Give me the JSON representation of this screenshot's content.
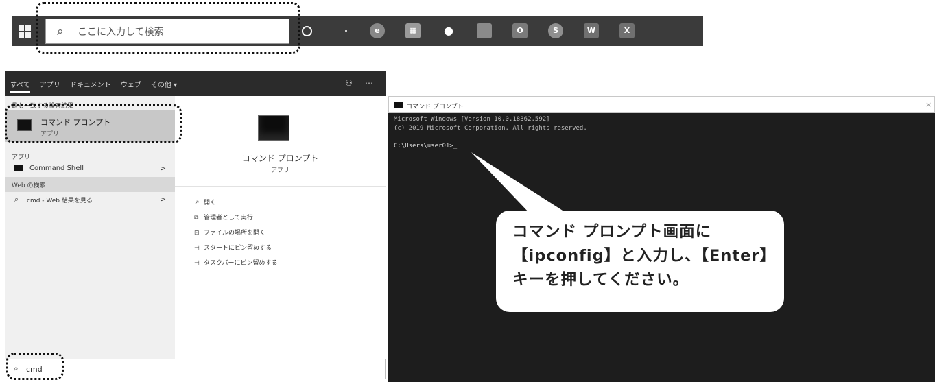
{
  "taskbar": {
    "search_icon": "search-icon",
    "search_placeholder": "ここに入力して検索",
    "apps": [
      "edge-icon",
      "calculator-icon",
      "wechat-icon",
      "file-explorer-icon",
      "outlook-icon",
      "skype-icon",
      "word-icon",
      "excel-icon"
    ]
  },
  "start_menu": {
    "tabs": [
      "すべて",
      "アプリ",
      "ドキュメント",
      "ウェブ",
      "その他"
    ],
    "tab_more": "▾",
    "more_icon": "ellipsis-icon",
    "best_match_heading": "最も一致する検索結果",
    "best_match": {
      "name": "コマンド プロンプト",
      "sub": "アプリ"
    },
    "apps_heading": "アプリ",
    "apps": [
      {
        "name": "Command Shell",
        "arrow": ">"
      }
    ],
    "web_heading": "Web の検索",
    "web_result": {
      "text": "cmd - Web 結果を見る",
      "arrow": ">"
    },
    "preview": {
      "name": "コマンド プロンプト",
      "sub": "アプリ"
    },
    "actions": [
      {
        "icon": "↗",
        "label": "開く"
      },
      {
        "icon": "⧉",
        "label": "管理者として実行"
      },
      {
        "icon": "⊡",
        "label": "ファイルの場所を開く"
      },
      {
        "icon": "⊣",
        "label": "スタートにピン留めする"
      },
      {
        "icon": "⊣",
        "label": "タスクバーにピン留めする"
      }
    ],
    "search_text": "cmd"
  },
  "cmd_window": {
    "title": "コマンド プロンプト",
    "close": "×",
    "lines": [
      "Microsoft Windows [Version 10.0.18362.592]",
      "(c) 2019 Microsoft Corporation. All rights reserved.",
      "",
      "C:\\Users\\user01>_"
    ]
  },
  "callout": {
    "lines": [
      "コマンド プロンプト画面に",
      "【ipconfig】と入力し、【Enter】",
      "キーを押してください。"
    ]
  }
}
